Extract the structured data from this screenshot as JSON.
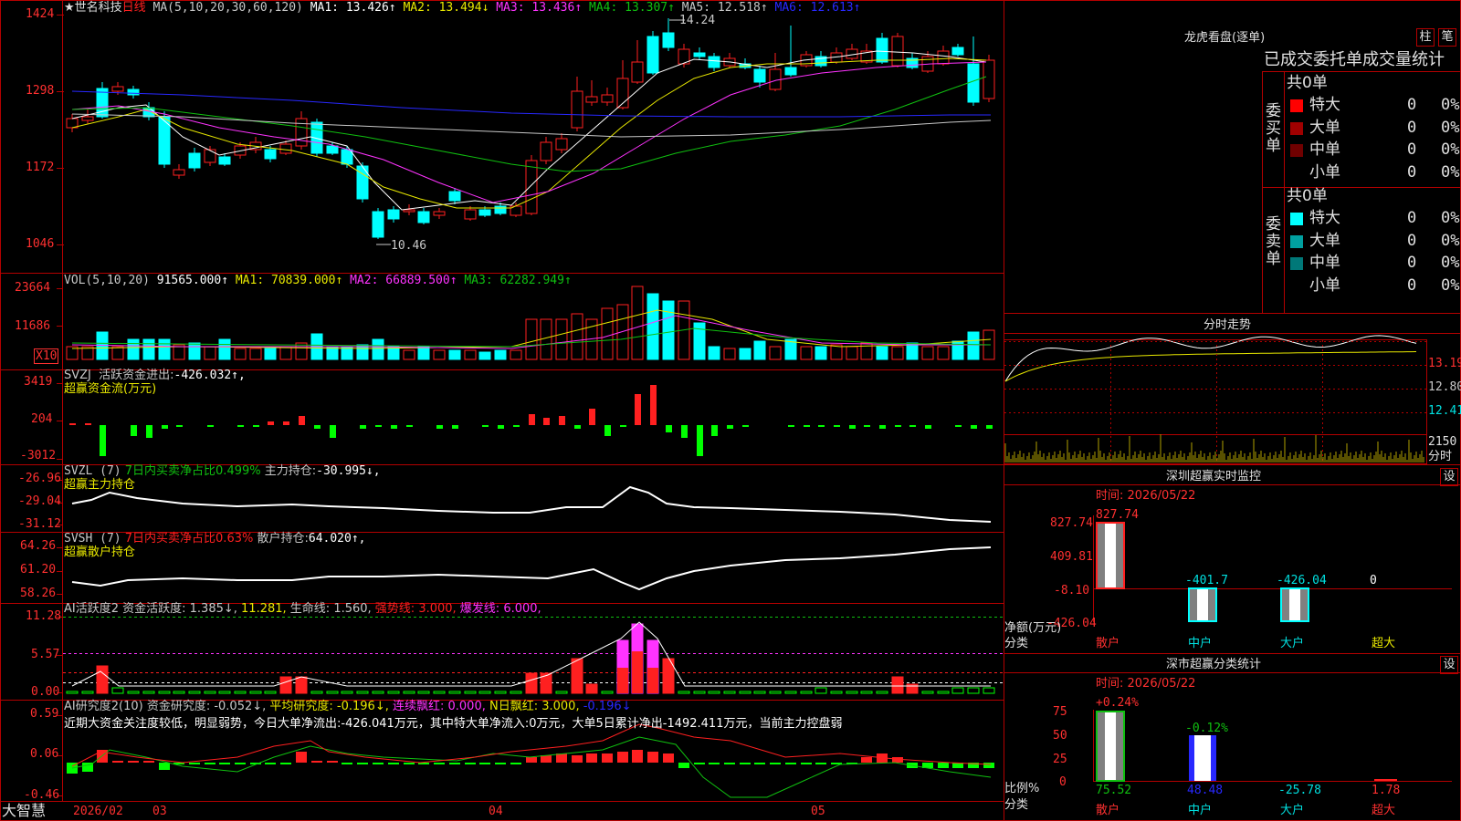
{
  "stock": {
    "name": "★世名科技",
    "period": "日线",
    "ma_header": "MA(5,10,20,30,60,120)",
    "ma": [
      {
        "label": "MA1:",
        "value": "13.426↑",
        "color": "#ffffff"
      },
      {
        "label": "MA2:",
        "value": "13.494↓",
        "color": "#e8e800"
      },
      {
        "label": "MA3:",
        "value": "13.436↑",
        "color": "#ff33ff"
      },
      {
        "label": "MA4:",
        "value": "13.307↑",
        "color": "#10c010"
      },
      {
        "label": "MA5:",
        "value": "12.518↑",
        "color": "#c8c8c8"
      },
      {
        "label": "MA6:",
        "value": "12.613↑",
        "color": "#2828ff"
      }
    ],
    "price_axis": [
      "1424",
      "1298",
      "1172",
      "1046"
    ],
    "high_label": "14.24",
    "low_label": "10.46"
  },
  "volume": {
    "header": "VOL(5,10,20)",
    "value": "91565.000↑",
    "mas": [
      {
        "label": "MA1:",
        "value": "70839.000↑",
        "color": "#e8e800"
      },
      {
        "label": "MA2:",
        "value": "66889.500↑",
        "color": "#ff33ff"
      },
      {
        "label": "MA3:",
        "value": "62282.949↑",
        "color": "#10c010"
      }
    ],
    "axis": [
      "23664",
      "11686"
    ],
    "unit": "X10"
  },
  "svzj": {
    "header": "SVZJ  活跃资金进出:",
    "value": "-426.032↑,",
    "subtitle": "超赢资金流(万元)",
    "axis": [
      "3419",
      "204",
      "-3012"
    ]
  },
  "svzl": {
    "header": "SVZL (7)",
    "ratio": "7日内买卖净占比0.499%",
    "label": "主力持仓:",
    "value": "-30.995↓,",
    "subtitle": "超赢主力持仓",
    "axis": [
      "-26.96",
      "-29.04",
      "-31.12"
    ]
  },
  "svsh": {
    "header": "SVSH (7)",
    "ratio": "7日内买卖净占比0.63%",
    "label": "散户持仓:",
    "value": "64.020↑,",
    "subtitle": "超赢散户持仓",
    "axis": [
      "64.26",
      "61.20",
      "58.26"
    ]
  },
  "ai_active": {
    "header": "AI活跃度2",
    "items": [
      {
        "text": "资金活跃度: 1.385↓,",
        "color": "#c8c8c8"
      },
      {
        "text": " 11.281,",
        "color": "#e8e800"
      },
      {
        "text": " 生命线: 1.560,",
        "color": "#c8c8c8"
      },
      {
        "text": " 强势线: 3.000,",
        "color": "#ff2020"
      },
      {
        "text": " 爆发线: 6.000,",
        "color": "#ff33ff"
      }
    ],
    "axis": [
      "11.28",
      "5.57",
      "0.00"
    ]
  },
  "ai_research": {
    "header": "AI研究度2(10)",
    "items": [
      {
        "text": "资金研究度: -0.052↓,",
        "color": "#c8c8c8"
      },
      {
        "text": " 平均研究度: -0.196↓,",
        "color": "#e8e800"
      },
      {
        "text": " 连续飘红: 0.000,",
        "color": "#ff33ff"
      },
      {
        "text": " N日飘红: 3.000,",
        "color": "#e8e800"
      },
      {
        "text": " -0.196↓",
        "color": "#2828ff"
      }
    ],
    "note": "近期大资金关注度较低，明显弱势，今日大单净流出:-426.041万元，其中特大单净流入:0万元，大单5日累计净出-1492.411万元，当前主力控盘弱",
    "axis": [
      "0.59",
      "0.06",
      "-0.46"
    ]
  },
  "bottom_bar": {
    "brand": "大智慧",
    "dates": [
      "2026/02",
      "03",
      "04",
      "05"
    ]
  },
  "dragon": {
    "title": "龙虎看盘(逐单)",
    "btn_zhu": "柱",
    "btn_bi": "笔",
    "subtitle": "已成交委托单成交量统计",
    "buy_label": "委买单",
    "sell_label": "委卖单",
    "buy_total": "共0单",
    "sell_total": "共0单",
    "buy_rows": [
      {
        "name": "特大",
        "count": "0",
        "pct": "0%",
        "color": "#ff0000"
      },
      {
        "name": "大单",
        "count": "0",
        "pct": "0%",
        "color": "#a00000"
      },
      {
        "name": "中单",
        "count": "0",
        "pct": "0%",
        "color": "#700000"
      },
      {
        "name": "小单",
        "count": "0",
        "pct": "0%",
        "color": ""
      }
    ],
    "sell_rows": [
      {
        "name": "特大",
        "count": "0",
        "pct": "0%",
        "color": "#00ffff"
      },
      {
        "name": "大单",
        "count": "0",
        "pct": "0%",
        "color": "#00a0a0"
      },
      {
        "name": "中单",
        "count": "0",
        "pct": "0%",
        "color": "#007878"
      },
      {
        "name": "小单",
        "count": "0",
        "pct": "0%",
        "color": ""
      }
    ]
  },
  "intraday": {
    "title": "分时走势",
    "axis": [
      "13.19",
      "12.80",
      "12.41"
    ],
    "vol_axis": "2150",
    "vol_unit": "分时"
  },
  "sz_monitor": {
    "title": "深圳超赢实时监控",
    "set": "设",
    "time": "时间: 2026/05/22",
    "axis": [
      "827.74",
      "409.81",
      "-8.10",
      "-426.04"
    ],
    "top_value": "827.74",
    "y_title": "净额(万元)",
    "x_title": "分类",
    "bars": [
      {
        "cat": "散户",
        "value": "827.74"
      },
      {
        "cat": "中户",
        "value": "-401.7"
      },
      {
        "cat": "大户",
        "value": "-426.04"
      },
      {
        "cat": "超大",
        "value": "0"
      }
    ]
  },
  "sz_stats": {
    "title": "深市超赢分类统计",
    "set": "设",
    "time": "时间: 2026/05/22",
    "axis": [
      "75",
      "50",
      "25",
      "0"
    ],
    "y_title": "比例%",
    "x_title": "分类",
    "top_labels": [
      "+0.24%",
      "-0.12%"
    ],
    "bars": [
      {
        "cat": "散户",
        "value": "75.52"
      },
      {
        "cat": "中户",
        "value": "48.48"
      },
      {
        "cat": "大户",
        "value": "-25.78"
      },
      {
        "cat": "超大",
        "value": "1.78"
      }
    ]
  },
  "chart_data": [
    {
      "type": "line",
      "title": "",
      "ylim": [
        10.46,
        14.24
      ],
      "series": [
        {
          "name": "MA1",
          "values": [
            13.426
          ]
        },
        {
          "name": "MA2",
          "values": [
            13.494
          ]
        },
        {
          "name": "MA3",
          "values": [
            13.436
          ]
        },
        {
          "name": "MA4",
          "values": [
            13.307
          ]
        },
        {
          "name": "MA5",
          "values": [
            12.518
          ]
        },
        {
          "name": "MA6",
          "values": [
            12.613
          ]
        }
      ]
    },
    {
      "type": "bar",
      "title": "",
      "series": [
        {
          "name": "VOL",
          "values": [
            91565.0
          ]
        },
        {
          "name": "MA1",
          "values": [
            70839.0
          ]
        },
        {
          "name": "MA2",
          "values": [
            66889.5
          ]
        },
        {
          "name": "MA3",
          "values": [
            62282.949
          ]
        }
      ]
    },
    {
      "type": "bar",
      "title": "深圳超赢实时监控",
      "categories": [
        "散户",
        "中户",
        "大户",
        "超大"
      ],
      "values": [
        827.74,
        -401.7,
        -426.04,
        0
      ],
      "ylabel": "净额(万元)",
      "xlabel": "分类",
      "ylim": [
        -426.04,
        827.74
      ]
    },
    {
      "type": "bar",
      "title": "深市超赢分类统计",
      "categories": [
        "散户",
        "中户",
        "大户",
        "超大"
      ],
      "values": [
        75.52,
        48.48,
        -25.78,
        1.78
      ],
      "ylabel": "比例%",
      "xlabel": "分类",
      "ylim": [
        0,
        75
      ]
    }
  ]
}
